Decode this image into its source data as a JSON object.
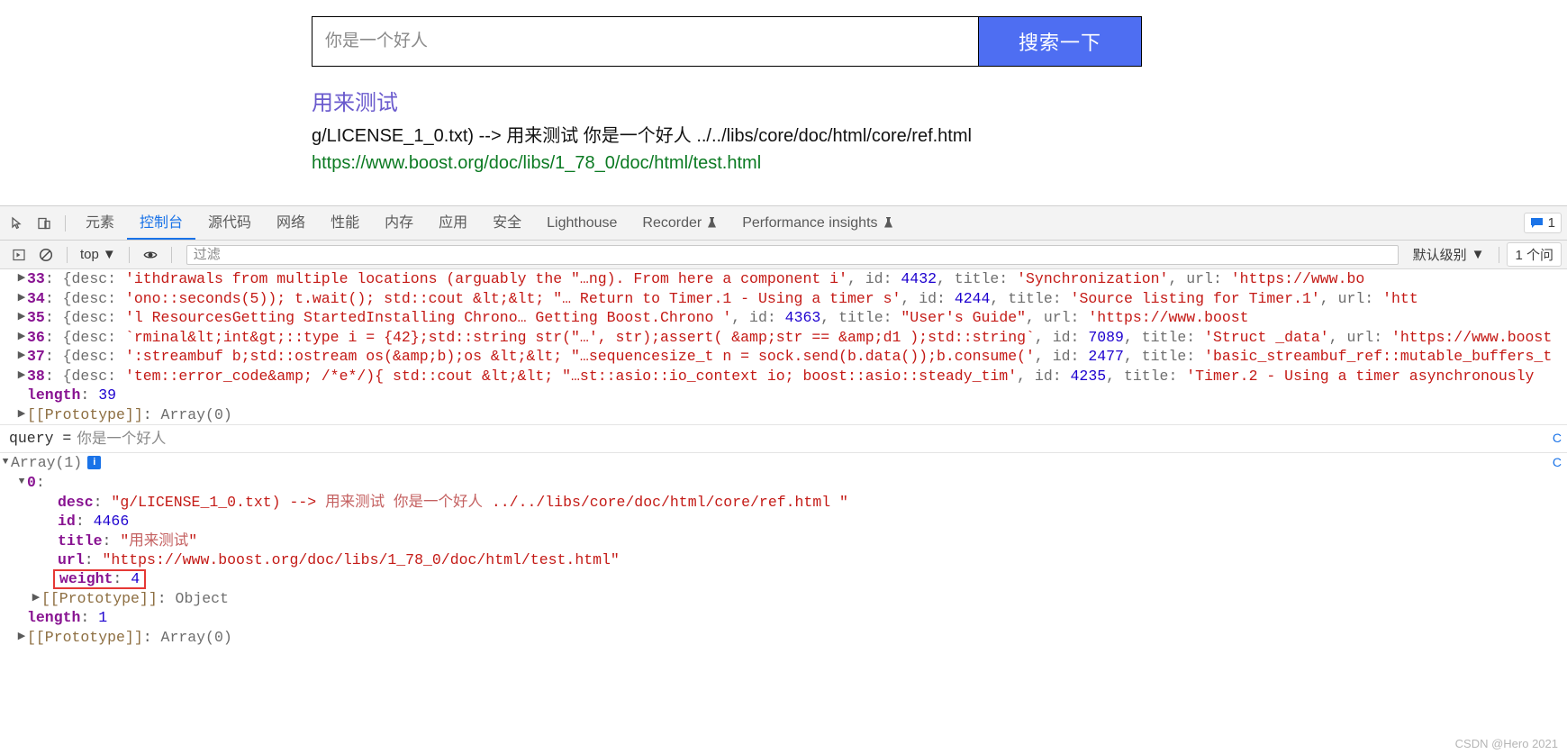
{
  "page": {
    "search": {
      "placeholder": "你是一个好人",
      "value": "",
      "button_label": "搜索一下"
    },
    "results": [
      {
        "title": "用来测试",
        "desc": "g/LICENSE_1_0.txt) --> 用来测试 你是一个好人 ../../libs/core/doc/html/core/ref.html",
        "url": "https://www.boost.org/doc/libs/1_78_0/doc/html/test.html"
      }
    ]
  },
  "devtools": {
    "tabs": [
      {
        "label": "元素",
        "active": false,
        "flask": false
      },
      {
        "label": "控制台",
        "active": true,
        "flask": false
      },
      {
        "label": "源代码",
        "active": false,
        "flask": false
      },
      {
        "label": "网络",
        "active": false,
        "flask": false
      },
      {
        "label": "性能",
        "active": false,
        "flask": false
      },
      {
        "label": "内存",
        "active": false,
        "flask": false
      },
      {
        "label": "应用",
        "active": false,
        "flask": false
      },
      {
        "label": "安全",
        "active": false,
        "flask": false
      },
      {
        "label": "Lighthouse",
        "active": false,
        "flask": false
      },
      {
        "label": "Recorder",
        "active": false,
        "flask": true
      },
      {
        "label": "Performance insights",
        "active": false,
        "flask": true
      }
    ],
    "icons": {
      "inspect": "inspect-element-icon",
      "device": "device-toolbar-icon",
      "execute": "execute-icon",
      "clear": "clear-console-icon",
      "eye": "console-sidebar-eye-icon",
      "message": "message-icon"
    },
    "message_count": "1",
    "console_toolbar": {
      "context": "top",
      "filter_placeholder": "过滤",
      "filter_value": "",
      "level": "默认级别",
      "issues": "1 个问"
    },
    "console_lines": [
      {
        "indent": 1,
        "arrow": "▶",
        "parts": [
          {
            "t": "33",
            "c": "k-idx"
          },
          {
            "t": ": ",
            "c": "k-punct"
          },
          {
            "t": "{desc: ",
            "c": "k-gray"
          },
          {
            "t": "'ithdrawals from multiple locations (arguably the \"…ng).            From here a component i'",
            "c": "k-str"
          },
          {
            "t": ", id: ",
            "c": "k-gray"
          },
          {
            "t": "4432",
            "c": "k-num"
          },
          {
            "t": ", title: ",
            "c": "k-gray"
          },
          {
            "t": "'Synchronization'",
            "c": "k-str"
          },
          {
            "t": ", url: ",
            "c": "k-gray"
          },
          {
            "t": "'https://www.bo",
            "c": "k-str"
          }
        ]
      },
      {
        "indent": 1,
        "arrow": "▶",
        "parts": [
          {
            "t": "34",
            "c": "k-idx"
          },
          {
            "t": ": ",
            "c": "k-punct"
          },
          {
            "t": "{desc: ",
            "c": "k-gray"
          },
          {
            "t": "'ono::seconds(5));  t.wait();  std::cout &lt;&lt; \"…    Return to Timer.1 - Using        a timer s'",
            "c": "k-str"
          },
          {
            "t": ", id: ",
            "c": "k-gray"
          },
          {
            "t": "4244",
            "c": "k-num"
          },
          {
            "t": ", title: ",
            "c": "k-gray"
          },
          {
            "t": "'Source listing for Timer.1'",
            "c": "k-str"
          },
          {
            "t": ", url: ",
            "c": "k-gray"
          },
          {
            "t": "'htt",
            "c": "k-str"
          }
        ]
      },
      {
        "indent": 1,
        "arrow": "▶",
        "parts": [
          {
            "t": "35",
            "c": "k-idx"
          },
          {
            "t": ": ",
            "c": "k-punct"
          },
          {
            "t": "{desc: ",
            "c": "k-gray"
          },
          {
            "t": "'l ResourcesGetting StartedInstalling        Chrono…   Getting          Boost.Chrono            '",
            "c": "k-str"
          },
          {
            "t": ", id: ",
            "c": "k-gray"
          },
          {
            "t": "4363",
            "c": "k-num"
          },
          {
            "t": ", title: ",
            "c": "k-gray"
          },
          {
            "t": "\"User's Guide\"",
            "c": "k-str"
          },
          {
            "t": ", url: ",
            "c": "k-gray"
          },
          {
            "t": "'https://www.boost",
            "c": "k-str"
          }
        ]
      },
      {
        "indent": 1,
        "arrow": "▶",
        "parts": [
          {
            "t": "36",
            "c": "k-idx"
          },
          {
            "t": ": ",
            "c": "k-punct"
          },
          {
            "t": "{desc: ",
            "c": "k-gray"
          },
          {
            "t": "`rminal&lt;int&gt;::type i = {42};std::string str(\"…', str);assert( &amp;str == &amp;d1 );std::string`",
            "c": "k-str"
          },
          {
            "t": ", id: ",
            "c": "k-gray"
          },
          {
            "t": "7089",
            "c": "k-num"
          },
          {
            "t": ", title: ",
            "c": "k-gray"
          },
          {
            "t": "'Struct _data'",
            "c": "k-str"
          },
          {
            "t": ", url: ",
            "c": "k-gray"
          },
          {
            "t": "'https://www.boost",
            "c": "k-str"
          }
        ]
      },
      {
        "indent": 1,
        "arrow": "▶",
        "parts": [
          {
            "t": "37",
            "c": "k-idx"
          },
          {
            "t": ": ",
            "c": "k-punct"
          },
          {
            "t": "{desc: ",
            "c": "k-gray"
          },
          {
            "t": "':streambuf b;std::ostream os(&amp;b);os &lt;&lt; \"…sequencesize_t n = sock.send(b.data());b.consume('",
            "c": "k-str"
          },
          {
            "t": ", id: ",
            "c": "k-gray"
          },
          {
            "t": "2477",
            "c": "k-num"
          },
          {
            "t": ", title: ",
            "c": "k-gray"
          },
          {
            "t": "'basic_streambuf_ref::mutable_buffers_t",
            "c": "k-str"
          }
        ]
      },
      {
        "indent": 1,
        "arrow": "▶",
        "parts": [
          {
            "t": "38",
            "c": "k-idx"
          },
          {
            "t": ": ",
            "c": "k-punct"
          },
          {
            "t": "{desc: ",
            "c": "k-gray"
          },
          {
            "t": "'tem::error_code&amp; /*e*/){  std::cout &lt;&lt; \"…st::asio::io_context io;  boost::asio::steady_tim'",
            "c": "k-str"
          },
          {
            "t": ", id: ",
            "c": "k-gray"
          },
          {
            "t": "4235",
            "c": "k-num"
          },
          {
            "t": ", title: ",
            "c": "k-gray"
          },
          {
            "t": "'Timer.2 - Using a timer asynchronously",
            "c": "k-str"
          }
        ]
      },
      {
        "indent": 1,
        "arrow": "",
        "parts": [
          {
            "t": "length",
            "c": "k-prop"
          },
          {
            "t": ": ",
            "c": "k-punct"
          },
          {
            "t": "39",
            "c": "k-num"
          }
        ]
      },
      {
        "indent": 1,
        "arrow": "▶",
        "parts": [
          {
            "t": "[[Prototype]]",
            "c": "k-proto"
          },
          {
            "t": ": ",
            "c": "k-punct"
          },
          {
            "t": "Array(0)",
            "c": "k-gray"
          }
        ]
      }
    ],
    "query_echo": {
      "prefix": "query = ",
      "value": "你是一个好人"
    },
    "result_lines": [
      {
        "indent": 0,
        "arrow": "▼",
        "badge": "i",
        "parts": [
          {
            "t": "Array(1)",
            "c": "k-gray"
          }
        ]
      },
      {
        "indent": 1,
        "arrow": "▼",
        "parts": [
          {
            "t": "0",
            "c": "k-idx"
          },
          {
            "t": ":",
            "c": "k-punct"
          }
        ]
      },
      {
        "indent": 3,
        "arrow": "",
        "parts": [
          {
            "t": "desc",
            "c": "k-prop"
          },
          {
            "t": ": ",
            "c": "k-punct"
          },
          {
            "t": "\"g/LICENSE_1_0.txt) -->    ",
            "c": "k-str"
          },
          {
            "t": "用来测试",
            "c": "k-cjk"
          },
          {
            "t": "          ",
            "c": "k-str"
          },
          {
            "t": "你是一个好人",
            "c": "k-cjk"
          },
          {
            "t": "   ../../libs/core/doc/html/core/ref.html \"",
            "c": "k-str"
          }
        ]
      },
      {
        "indent": 3,
        "arrow": "",
        "parts": [
          {
            "t": "id",
            "c": "k-prop"
          },
          {
            "t": ": ",
            "c": "k-punct"
          },
          {
            "t": "4466",
            "c": "k-num"
          }
        ]
      },
      {
        "indent": 3,
        "arrow": "",
        "parts": [
          {
            "t": "title",
            "c": "k-prop"
          },
          {
            "t": ": ",
            "c": "k-punct"
          },
          {
            "t": "\"",
            "c": "k-str"
          },
          {
            "t": "用来测试",
            "c": "k-cjk"
          },
          {
            "t": "\"",
            "c": "k-str"
          }
        ]
      },
      {
        "indent": 3,
        "arrow": "",
        "parts": [
          {
            "t": "url",
            "c": "k-prop"
          },
          {
            "t": ": ",
            "c": "k-punct"
          },
          {
            "t": "\"https://www.boost.org/doc/libs/1_78_0/doc/html/test.html\"",
            "c": "k-str"
          }
        ]
      },
      {
        "indent": 3,
        "arrow": "",
        "highlight": true,
        "parts": [
          {
            "t": "weight",
            "c": "k-prop"
          },
          {
            "t": ": ",
            "c": "k-punct"
          },
          {
            "t": "4",
            "c": "k-num"
          }
        ]
      },
      {
        "indent": 2,
        "arrow": "▶",
        "parts": [
          {
            "t": "[[Prototype]]",
            "c": "k-proto"
          },
          {
            "t": ": ",
            "c": "k-punct"
          },
          {
            "t": "Object",
            "c": "k-gray"
          }
        ]
      },
      {
        "indent": 1,
        "arrow": "",
        "parts": [
          {
            "t": "length",
            "c": "k-prop"
          },
          {
            "t": ": ",
            "c": "k-punct"
          },
          {
            "t": "1",
            "c": "k-num"
          }
        ]
      },
      {
        "indent": 1,
        "arrow": "▶",
        "parts": [
          {
            "t": "[[Prototype]]",
            "c": "k-proto"
          },
          {
            "t": ": ",
            "c": "k-punct"
          },
          {
            "t": "Array(0)",
            "c": "k-gray"
          }
        ]
      }
    ],
    "source_links": [
      "C",
      "C"
    ]
  },
  "watermark": "CSDN @Hero 2021",
  "colors": {
    "accent": "#4e6ef2",
    "link": "#6a5acd",
    "url_green": "#0b7a22",
    "devtools_active": "#1a73e8",
    "string_red": "#c41a16",
    "number_blue": "#1c00cf",
    "prop_purple": "#881391",
    "highlight_red": "#e53935"
  }
}
